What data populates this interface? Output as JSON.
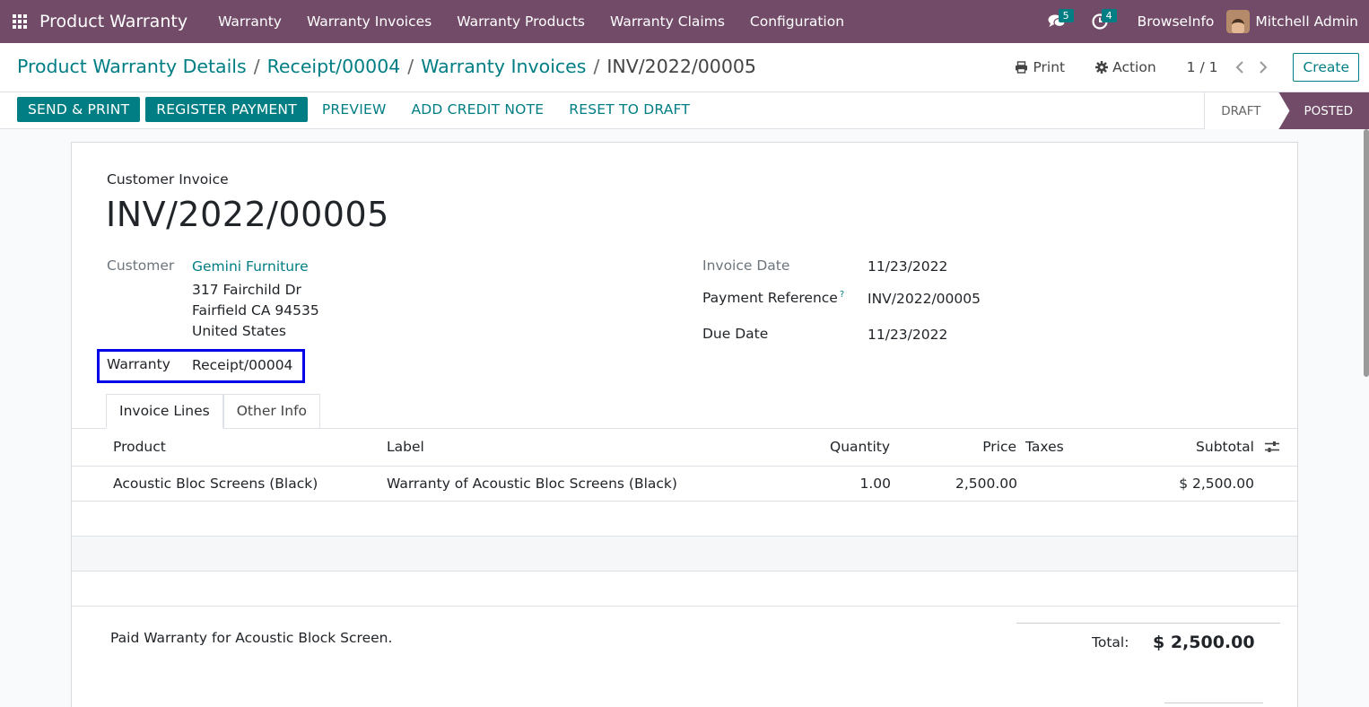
{
  "navbar": {
    "brand": "Product Warranty",
    "menu": [
      "Warranty",
      "Warranty Invoices",
      "Warranty Products",
      "Warranty Claims",
      "Configuration"
    ],
    "messages_count": "5",
    "activities_count": "4",
    "company": "BrowseInfo",
    "user": "Mitchell Admin",
    "bg_color": "#714b67"
  },
  "breadcrumb": {
    "items": [
      "Product Warranty Details",
      "Receipt/00004",
      "Warranty Invoices"
    ],
    "active": "INV/2022/00005",
    "separator": "/"
  },
  "control": {
    "print_label": "Print",
    "action_label": "Action",
    "pager": "1 / 1",
    "create_label": "Create"
  },
  "statusbar": {
    "buttons": {
      "send_print": "SEND & PRINT",
      "register_payment": "REGISTER PAYMENT",
      "preview": "PREVIEW",
      "add_credit_note": "ADD CREDIT NOTE",
      "reset_to_draft": "RESET TO DRAFT"
    },
    "states": {
      "draft": "DRAFT",
      "posted": "POSTED",
      "current": "POSTED"
    },
    "accent_color": "#017e84"
  },
  "invoice": {
    "type": "Customer Invoice",
    "name": "INV/2022/00005",
    "customer_label": "Customer",
    "customer_name": "Gemini Furniture",
    "address_line1": "317 Fairchild Dr",
    "address_line2": "Fairfield CA 94535",
    "address_line3": "United States",
    "warranty_label": "Warranty",
    "warranty_value": "Receipt/00004",
    "invoice_date_label": "Invoice Date",
    "invoice_date": "11/23/2022",
    "payment_ref_label": "Payment Reference",
    "payment_ref_tooltip": "?",
    "payment_ref": "INV/2022/00005",
    "due_date_label": "Due Date",
    "due_date": "11/23/2022"
  },
  "tabs": [
    "Invoice Lines",
    "Other Info"
  ],
  "lines": {
    "headers": {
      "product": "Product",
      "label": "Label",
      "quantity": "Quantity",
      "price": "Price",
      "taxes": "Taxes",
      "subtotal": "Subtotal"
    },
    "rows": [
      {
        "product": "Acoustic Bloc Screens (Black)",
        "label": "Warranty of Acoustic Bloc Screens (Black)",
        "quantity": "1.00",
        "price": "2,500.00",
        "taxes": "",
        "subtotal": "$ 2,500.00"
      }
    ]
  },
  "footer": {
    "notes": "Paid Warranty for Acoustic Block Screen.",
    "total_label": "Total:",
    "total_value": "$ 2,500.00"
  }
}
